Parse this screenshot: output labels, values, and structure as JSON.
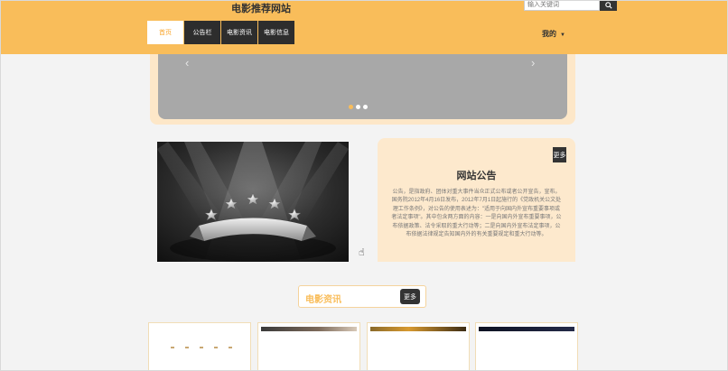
{
  "header": {
    "site_title": "电影推荐网站",
    "search_placeholder": "输入关键词",
    "nav": [
      {
        "label": "首页",
        "active": true
      },
      {
        "label": "公告栏",
        "active": false
      },
      {
        "label": "电影资讯",
        "active": false
      },
      {
        "label": "电影信息",
        "active": false
      }
    ],
    "user_menu": "我的"
  },
  "carousel": {
    "prev_arrow": "‹",
    "next_arrow": "›",
    "slide_count": 3,
    "active_slide": 1
  },
  "notice": {
    "more_label": "更多",
    "title": "网站公告",
    "body": "公告，是指政府、团体对重大事件当众正式公布或者公开宣告，宣布。国务院2012年4月16日发布，2012年7月1日起施行的《党政机关公文处理工作条例》，对公告的使用表述为：\"适用于向国内外宣布重要事项或者法定事项\"。其中包含两方面的内容：一是向国内外宣布重要事项，公布依据政策、法令采取的重大行动等；二是向国内外宣布法定事项，公布依据法律规定告知国内外的有关重要规定和重大行动等。"
  },
  "news": {
    "title": "电影资讯",
    "more_label": "更多"
  },
  "colors": {
    "header": "#f9bd5a",
    "accent": "#f9bd5a",
    "dark": "#2d2d2d",
    "notice_bg": "#fde9cd"
  }
}
